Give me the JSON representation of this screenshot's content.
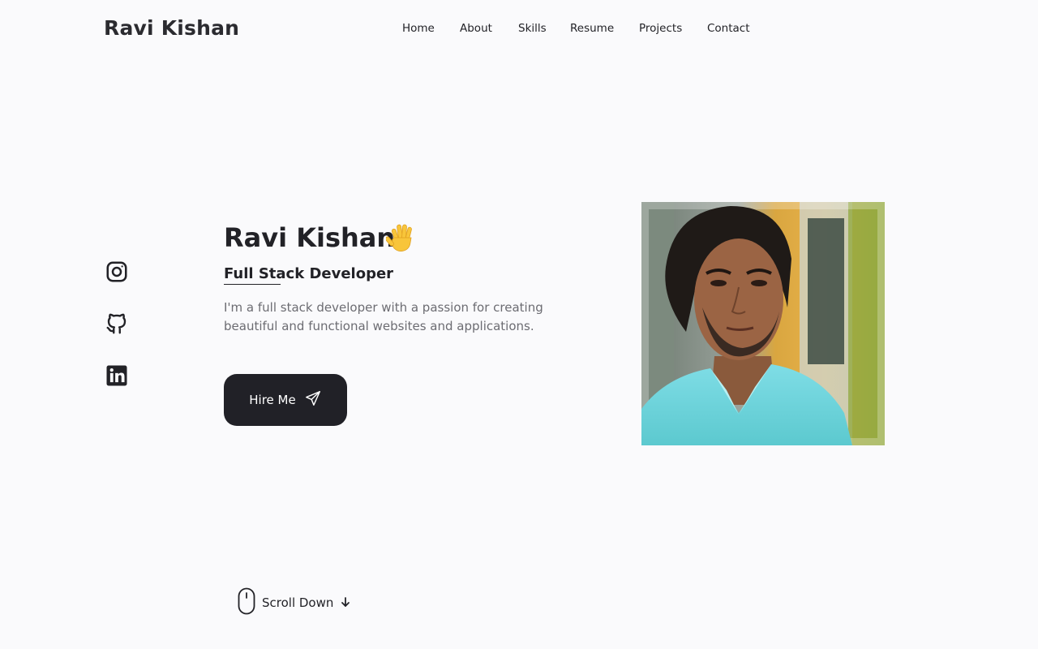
{
  "header": {
    "logo": "Ravi Kishan",
    "nav": [
      "Home",
      "About",
      "Skills",
      "Resume",
      "Projects",
      "Contact"
    ]
  },
  "socials": {
    "icons": [
      "instagram-icon",
      "github-icon",
      "linkedin-icon"
    ]
  },
  "hero": {
    "name": "Ravi Kishan",
    "wave_emoji": "waving-hand-icon",
    "role": "Full Stack Developer",
    "description": "I'm a full stack developer with a passion for creating beautiful and functional websites and applications.",
    "hire_label": "Hire Me",
    "scroll_label": "Scroll Down"
  },
  "colors": {
    "background": "#fafafc",
    "text": "#222227",
    "muted": "#6c6c72",
    "button": "#212127"
  }
}
